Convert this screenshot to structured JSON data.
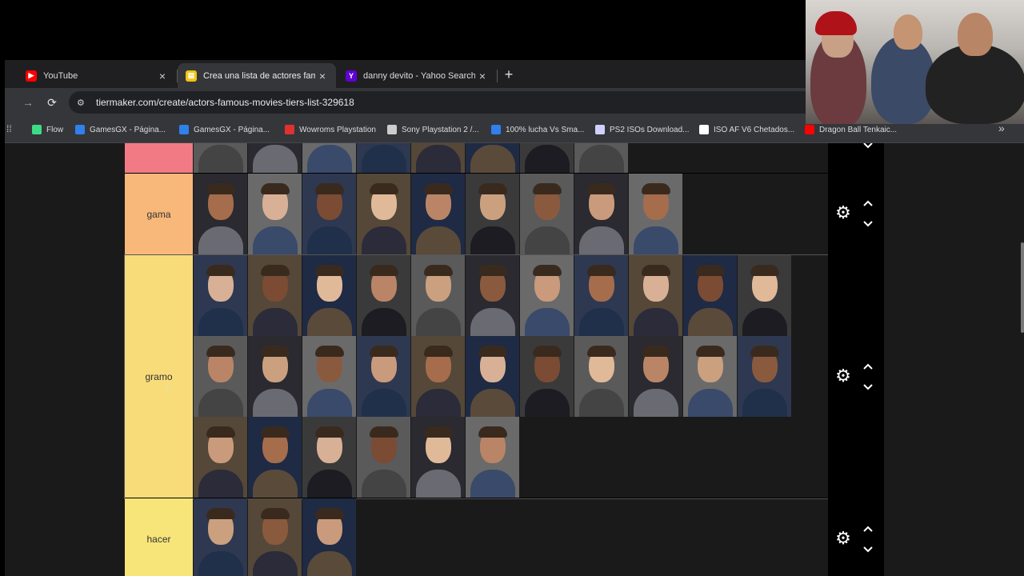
{
  "browser": {
    "tabs": [
      {
        "title": "YouTube",
        "fav_color": "#ff0000",
        "fav_glyph": "▶"
      },
      {
        "title": "Crea una lista de actores famosos",
        "fav_color": "#f1c40f",
        "fav_glyph": "▤"
      },
      {
        "title": "danny devito - Yahoo Search Tr",
        "fav_color": "#6001d2",
        "fav_glyph": "Y"
      }
    ],
    "active_tab_index": 1,
    "url": "tiermaker.com/create/actors-famous-movies-tiers-list-329618",
    "bookmarks": [
      {
        "label": "Flow",
        "color": "#3ddc84"
      },
      {
        "label": "GamesGX - Página...",
        "color": "#2f80ed"
      },
      {
        "label": "GamesGX - Página...",
        "color": "#2f80ed"
      },
      {
        "label": "Wowroms Playstation",
        "color": "#e03131"
      },
      {
        "label": "Sony Playstation 2 /...",
        "color": "#cccccc"
      },
      {
        "label": "100% lucha Vs Sma...",
        "color": "#2f80ed"
      },
      {
        "label": "PS2 ISOs Download...",
        "color": "#d0d0ff"
      },
      {
        "label": "ISO AF V6 Chetados...",
        "color": "#ffffff"
      },
      {
        "label": "Dragon Ball Tenkaic...",
        "color": "#ff0000"
      }
    ]
  },
  "tiers": [
    {
      "label": "",
      "color": "#f27a85",
      "rows_of_items": [
        8
      ]
    },
    {
      "label": "gama",
      "color": "#f8b87a",
      "rows_of_items": [
        9
      ]
    },
    {
      "label": "gramo",
      "color": "#f8dc7a",
      "rows_of_items": [
        11,
        11,
        6
      ]
    },
    {
      "label": "hacer",
      "color": "#f8e57a",
      "rows_of_items": [
        3
      ]
    }
  ],
  "palette": {
    "skin": [
      "#c99a7b",
      "#b98566",
      "#d8b096",
      "#8a5a3e",
      "#e0b999",
      "#a56d4c",
      "#caa07f",
      "#7b4b34"
    ],
    "hair": [
      "#3a2a1e",
      "#6b5a48",
      "#2a1f18",
      "#9a8a78",
      "#1c1410",
      "#c9b58f",
      "#4a3526"
    ],
    "cloth": [
      "#1c1c22",
      "#2b2b3a",
      "#3a4a6a",
      "#444",
      "#5a4a3a",
      "#20304a",
      "#6a6a72"
    ],
    "bg": [
      "#3a3a3a",
      "#5a5a5a",
      "#2a2a30",
      "#6a6a6a",
      "#2e3850",
      "#554838",
      "#1f2a44"
    ]
  }
}
